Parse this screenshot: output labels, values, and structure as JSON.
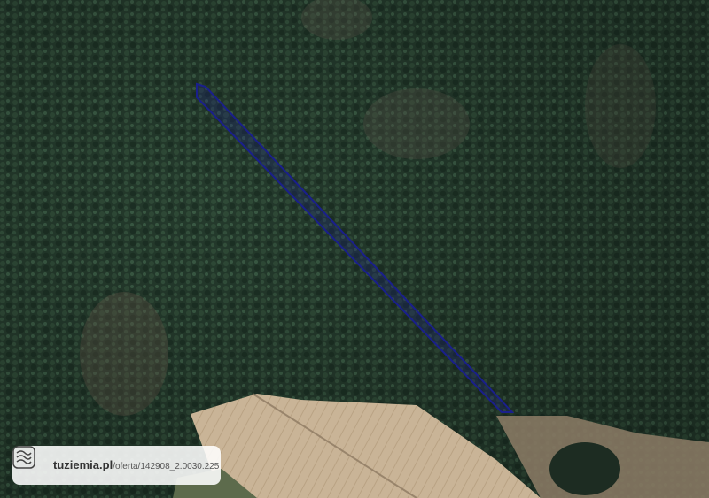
{
  "map": {
    "type": "satellite",
    "parcel_outline_color": "#1a1f8c"
  },
  "attribution": {
    "domain": "tuziemia.pl",
    "path": "/oferta/142908_2.0030.225",
    "icon": "contour-lines-icon"
  }
}
